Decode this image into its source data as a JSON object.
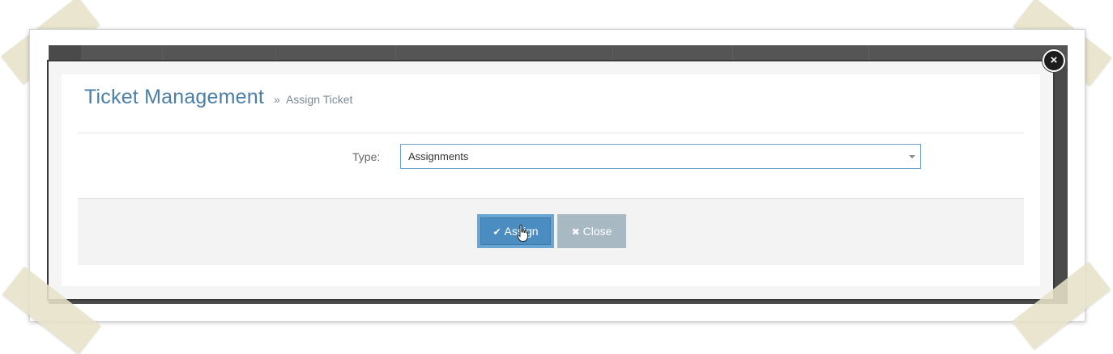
{
  "modal": {
    "title": "Ticket Management",
    "breadcrumb_separator": "»",
    "breadcrumb": "Assign Ticket",
    "form": {
      "type_label": "Type:",
      "type_value": "Assignments"
    },
    "buttons": {
      "assign_label": "Assign",
      "close_label": "Close"
    }
  },
  "icons": {
    "assign": "check-icon",
    "close": "x-icon",
    "modal_close": "close-circle-icon",
    "select_caret": "caret-down-icon",
    "cursor": "hand-pointer-icon"
  },
  "colors": {
    "title": "#4b7fa8",
    "assign_button": "#4c8dc1",
    "close_button": "#a9b9c4",
    "overlay": "#4a4a4a"
  }
}
